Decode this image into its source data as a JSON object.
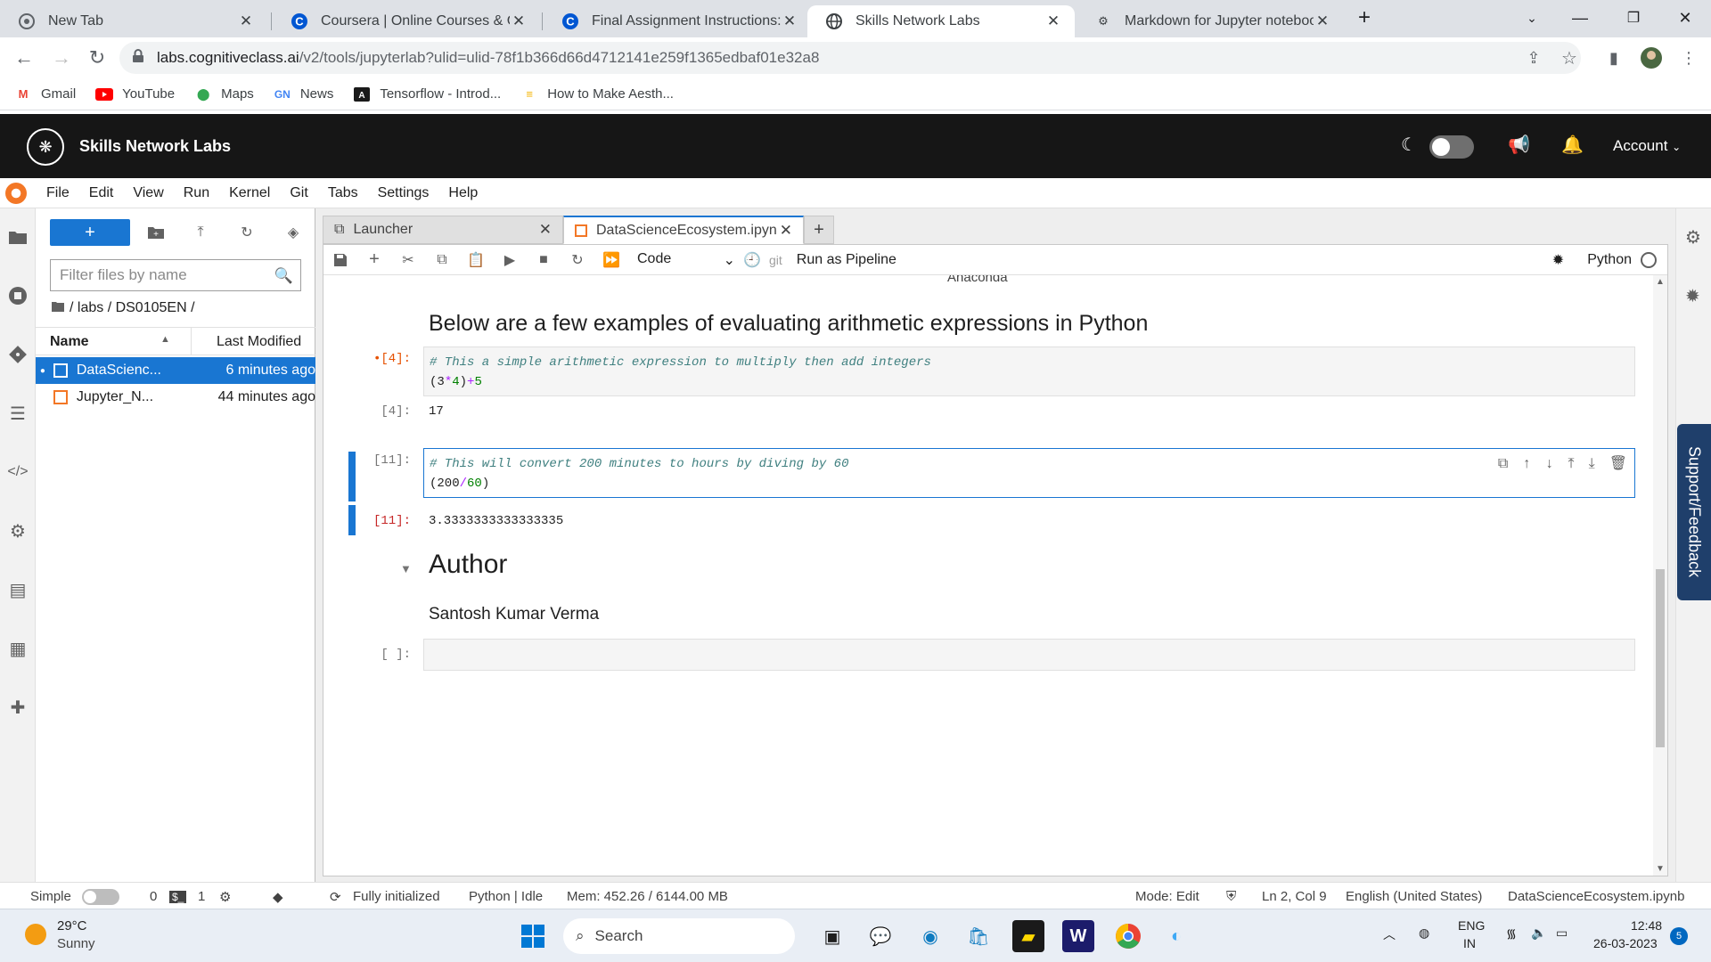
{
  "browser": {
    "tabs": [
      {
        "title": "New Tab"
      },
      {
        "title": "Coursera | Online Courses & Cred"
      },
      {
        "title": "Final Assignment Instructions: Cr"
      },
      {
        "title": "Skills Network Labs"
      },
      {
        "title": "Markdown for Jupyter notebooks"
      }
    ],
    "url_host": "labs.cognitiveclass.ai",
    "url_path": "/v2/tools/jupyterlab?ulid=ulid-78f1b366d66d4712141e259f1365edbaf01e32a8",
    "bookmarks": [
      "Gmail",
      "YouTube",
      "Maps",
      "News",
      "Tensorflow - Introd...",
      "How to Make Aesth..."
    ]
  },
  "snl": {
    "title": "Skills Network Labs",
    "account": "Account"
  },
  "menu": [
    "File",
    "Edit",
    "View",
    "Run",
    "Kernel",
    "Git",
    "Tabs",
    "Settings",
    "Help"
  ],
  "filebrowser": {
    "filter_placeholder": "Filter files by name",
    "breadcrumb": "/ labs / DS0105EN /",
    "col_name": "Name",
    "col_modified": "Last Modified",
    "files": [
      {
        "name": "DataScienc...",
        "modified": "6 minutes ago"
      },
      {
        "name": "Jupyter_N...",
        "modified": "44 minutes ago"
      }
    ]
  },
  "dock": {
    "tab_launcher": "Launcher",
    "tab_notebook": "DataScienceEcosystem.ipyn"
  },
  "toolbar": {
    "cell_type": "Code",
    "git": "git",
    "pipeline": "Run as Pipeline",
    "kernel": "Python"
  },
  "notebook": {
    "partial_text": "Anaconda",
    "heading": "Below are a few examples of evaluating arithmetic expressions in Python",
    "cell1": {
      "prompt": "•[4]:",
      "comment": "# This a simple arithmetic expression to multiply then add integers",
      "code_p1": "(3",
      "code_op1": "*",
      "code_n1": "4",
      "code_p2": ")",
      "code_op2": "+",
      "code_n2": "5",
      "out_prompt": "[4]:",
      "output": "17"
    },
    "cell2": {
      "prompt": "[11]:",
      "comment": "# This will convert 200 minutes to hours by diving by 60",
      "code_p1": "(200",
      "code_op": "/",
      "code_n": "60",
      "code_p2": ")",
      "out_prompt": "[11]:",
      "output": "3.3333333333333335"
    },
    "author_heading": "Author",
    "author_name": "Santosh Kumar Verma",
    "empty_prompt": "[ ]:"
  },
  "support": "Support/Feedback",
  "statusbar": {
    "mode_label": "Simple",
    "count_terminals": "0",
    "count_kernels": "1",
    "init": "Fully initialized",
    "kernel": "Python | Idle",
    "mem": "Mem: 452.26 / 6144.00 MB",
    "edit_mode": "Mode: Edit",
    "cursor": "Ln 2, Col 9",
    "language": "English (United States)",
    "filename": "DataScienceEcosystem.ipynb"
  },
  "taskbar": {
    "temp": "29°C",
    "weather": "Sunny",
    "search": "Search",
    "lang1": "ENG",
    "lang2": "IN",
    "time": "12:48",
    "date": "26-03-2023",
    "notif": "5"
  }
}
